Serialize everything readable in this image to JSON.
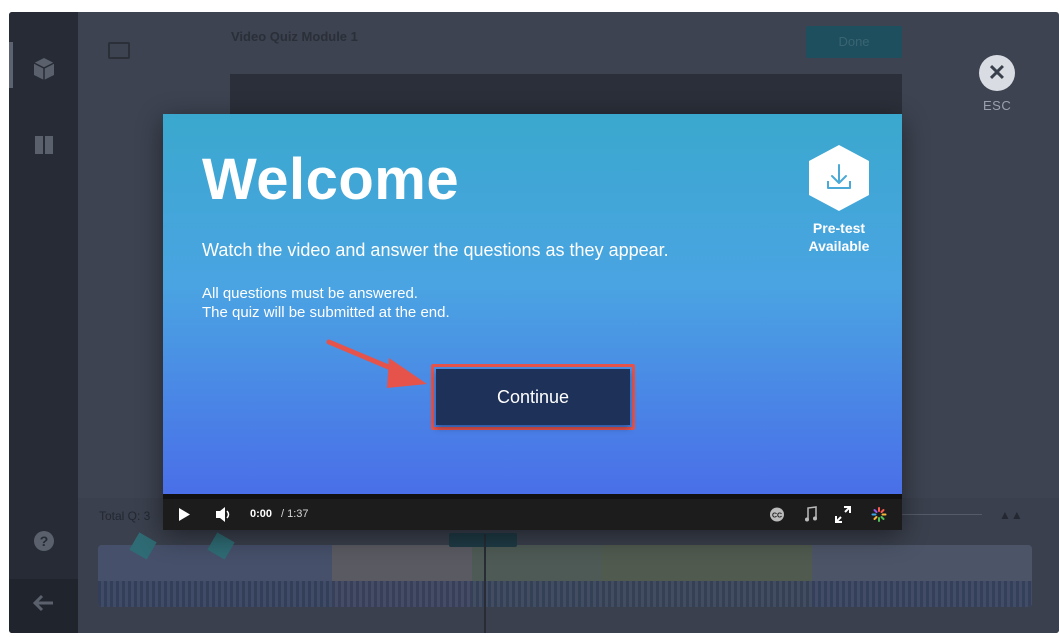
{
  "editor": {
    "module_title": "Video Quiz Module 1",
    "done_label": "Done",
    "esc_label": "ESC",
    "total_questions_label": "Total Q: 3"
  },
  "modal": {
    "heading": "Welcome",
    "instruction": "Watch the video and answer the questions as they appear.",
    "note_line1": "All questions must be answered.",
    "note_line2": "The quiz will be submitted at the end.",
    "pretest_line1": "Pre-test",
    "pretest_line2": "Available",
    "continue_label": "Continue"
  },
  "player": {
    "current_time": "0:00",
    "total_time": "/ 1:37",
    "progress": 0
  },
  "colors": {
    "continue_button": "#1e3158",
    "highlight": "#e5534b",
    "gradient_top": "#3aa8ce",
    "gradient_bottom": "#4a6fe8"
  }
}
